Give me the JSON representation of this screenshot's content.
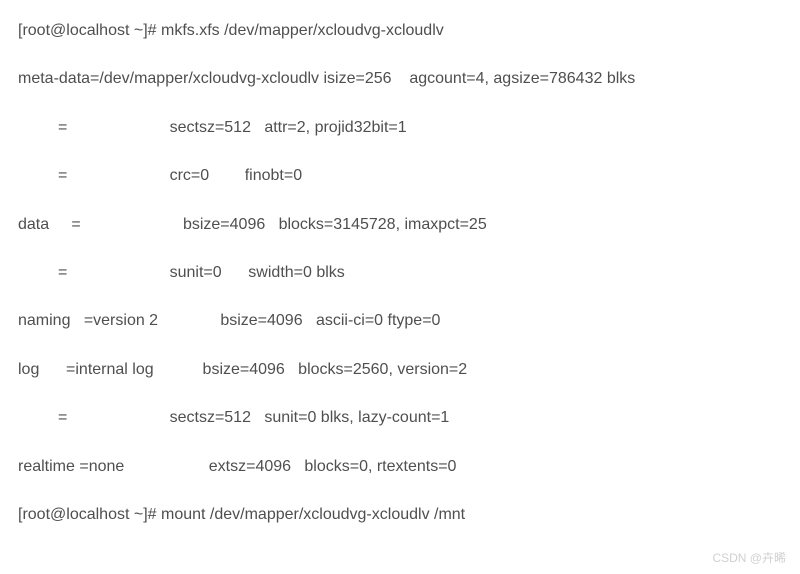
{
  "terminal": {
    "lines": [
      "[root@localhost ~]# mkfs.xfs /dev/mapper/xcloudvg-xcloudlv",
      "meta-data=/dev/mapper/xcloudvg-xcloudlv isize=256    agcount=4, agsize=786432 blks",
      "         =                       sectsz=512   attr=2, projid32bit=1",
      "         =                       crc=0        finobt=0",
      "data     =                       bsize=4096   blocks=3145728, imaxpct=25",
      "         =                       sunit=0      swidth=0 blks",
      "naming   =version 2              bsize=4096   ascii-ci=0 ftype=0",
      "log      =internal log           bsize=4096   blocks=2560, version=2",
      "         =                       sectsz=512   sunit=0 blks, lazy-count=1",
      "realtime =none                   extsz=4096   blocks=0, rtextents=0",
      "[root@localhost ~]# mount /dev/mapper/xcloudvg-xcloudlv /mnt"
    ]
  },
  "watermark": "CSDN @卉晞"
}
